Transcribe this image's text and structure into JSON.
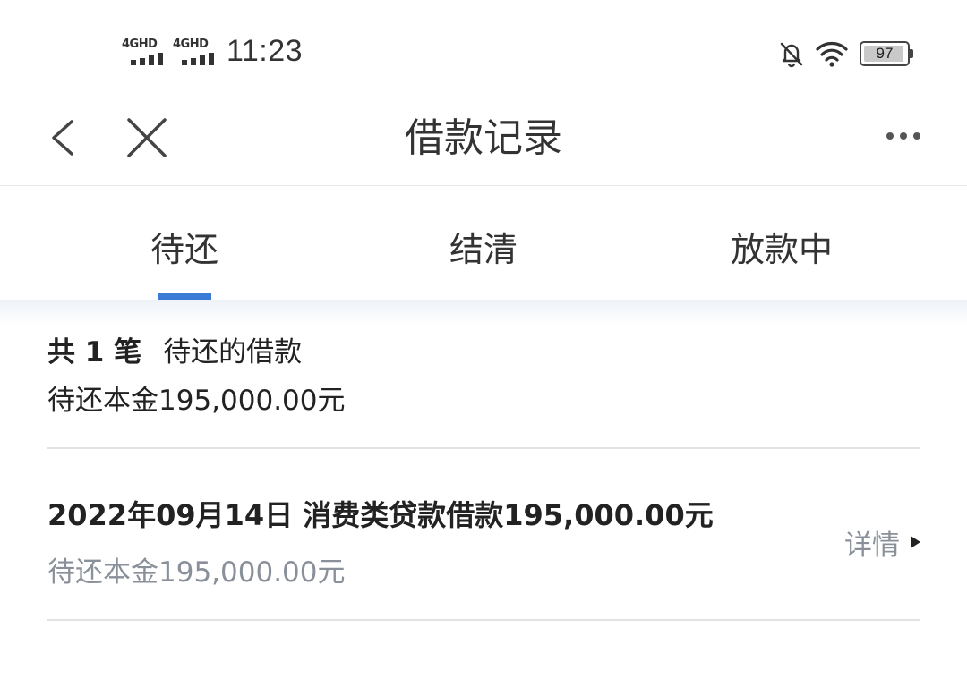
{
  "status_bar": {
    "network_1": "4GHD",
    "network_2": "4GHD",
    "time": "11:23",
    "battery": "97",
    "battery_level": 0.97,
    "icons": [
      "signal-icon",
      "signal-icon",
      "bell-muted-icon",
      "wifi-icon",
      "battery-icon"
    ]
  },
  "nav": {
    "title": "借款记录",
    "back_icon": "chevron-left-icon",
    "close_icon": "close-icon",
    "more_icon": "more-dots-icon"
  },
  "tabs": [
    {
      "label": "待还",
      "active": true
    },
    {
      "label": "结清",
      "active": false
    },
    {
      "label": "放款中",
      "active": false
    }
  ],
  "summary": {
    "count_label": "共 1 笔",
    "description": "待还的借款",
    "principal_line": "待还本金195,000.00元"
  },
  "loans": [
    {
      "title": "2022年09月14日 消费类贷款借款195,000.00元",
      "subtitle": "待还本金195,000.00元",
      "detail_label": "详情"
    }
  ],
  "colors": {
    "accent": "#3a7bd5",
    "text_primary": "#222222",
    "text_secondary": "#8a9099",
    "divider": "#e2e2e2"
  }
}
